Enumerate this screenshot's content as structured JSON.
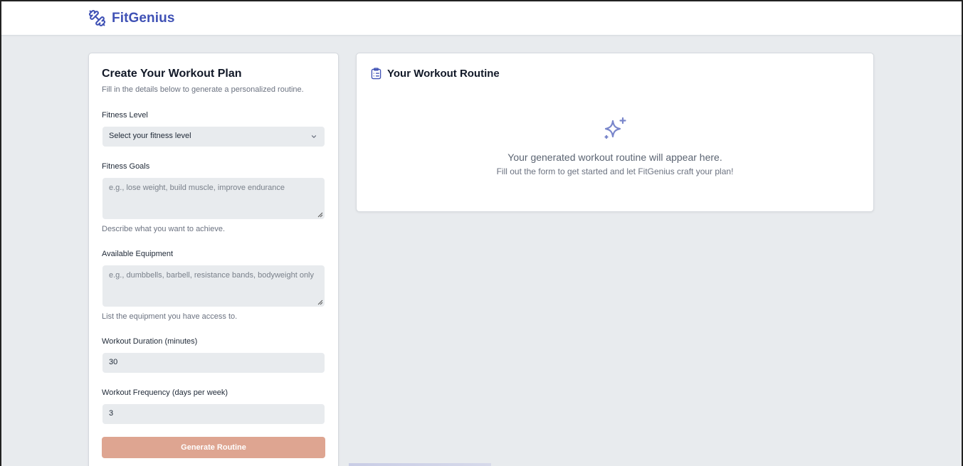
{
  "app": {
    "name": "FitGenius",
    "brand_color": "#3f51b5",
    "logo_icon": "dumbbell-icon"
  },
  "form": {
    "title": "Create Your Workout Plan",
    "subtitle": "Fill in the details below to generate a personalized routine.",
    "fitness_level": {
      "label": "Fitness Level",
      "selected": "Select your fitness level"
    },
    "fitness_goals": {
      "label": "Fitness Goals",
      "placeholder": "e.g., lose weight, build muscle, improve endurance",
      "help": "Describe what you want to achieve."
    },
    "equipment": {
      "label": "Available Equipment",
      "placeholder": "e.g., dumbbells, barbell, resistance bands, bodyweight only",
      "help": "List the equipment you have access to."
    },
    "duration": {
      "label": "Workout Duration (minutes)",
      "value": "30"
    },
    "frequency": {
      "label": "Workout Frequency (days per week)",
      "value": "3"
    },
    "submit_label": "Generate Routine",
    "submit_color": "#dea591"
  },
  "routine": {
    "title": "Your Workout Routine",
    "title_icon": "clipboard-list-icon",
    "empty_icon": "sparkles-icon",
    "empty_title": "Your generated workout routine will appear here.",
    "empty_subtitle": "Fill out the form to get started and let FitGenius craft your plan!"
  }
}
